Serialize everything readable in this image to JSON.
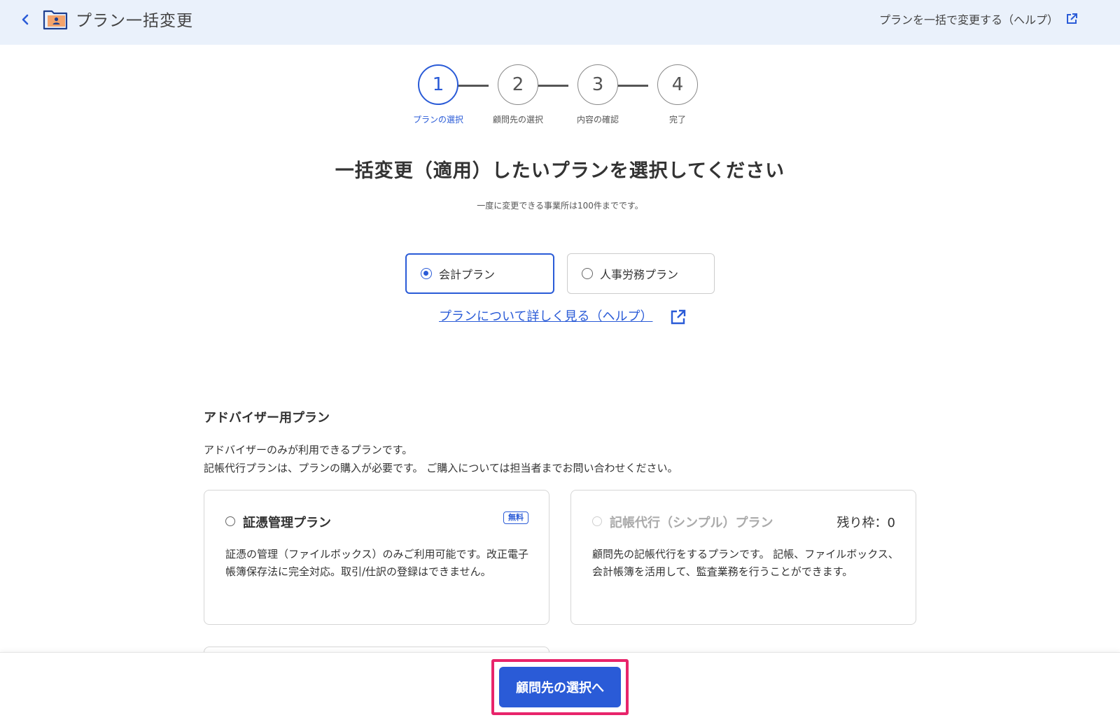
{
  "header": {
    "title": "プラン一括変更",
    "help_link": "プランを一括で変更する（ヘルプ）",
    "icons": {
      "back": "chevron-left-icon",
      "folder": "folder-user-icon",
      "external": "external-link-icon"
    }
  },
  "stepper": {
    "steps": [
      {
        "number": "1",
        "label": "プランの選択",
        "active": true
      },
      {
        "number": "2",
        "label": "顧問先の選択",
        "active": false
      },
      {
        "number": "3",
        "label": "内容の確認",
        "active": false
      },
      {
        "number": "4",
        "label": "完了",
        "active": false
      }
    ]
  },
  "heading": "一括変更（適用）したいプランを選択してください",
  "sub_note": "一度に変更できる事業所は100件までです。",
  "plan_types": {
    "selected": "会計プラン",
    "options": [
      {
        "label": "会計プラン",
        "checked": true
      },
      {
        "label": "人事労務プラン",
        "checked": false
      }
    ]
  },
  "plan_help": "プランについて詳しく見る（ヘルプ）",
  "section": {
    "title": "アドバイザー用プラン",
    "desc_line1": "アドバイザーのみが利用できるプランです。",
    "desc_line2": "記帳代行プランは、プランの購入が必要です。 ご購入については担当者までお問い合わせください。"
  },
  "cards": [
    {
      "title": "証憑管理プラン",
      "badge": "無料",
      "description": "証憑の管理（ファイルボックス）のみご利用可能です。改正電子帳簿保存法に完全対応。取引/仕訳の登録はできません。",
      "disabled": false
    },
    {
      "title": "記帳代行（シンプル）プラン",
      "slots": "残り枠：0",
      "description": "顧問先の記帳代行をするプランです。 記帳、ファイルボックス、会計帳簿を活用して、監査業務を行うことができます。",
      "disabled": true
    }
  ],
  "footer": {
    "next_button": "顧問先の選択へ"
  },
  "colors": {
    "accent": "#2a5bd7",
    "highlight": "#e8246b",
    "header_bg": "#eaf1fb"
  }
}
